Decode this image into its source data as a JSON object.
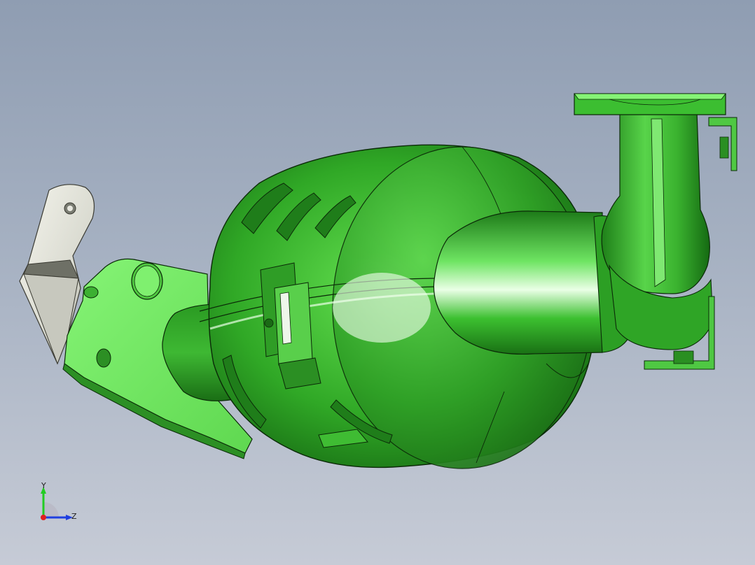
{
  "triad": {
    "y_label": "Y",
    "z_label": "Z",
    "colors": {
      "y_axis": "#22cc22",
      "z_axis": "#1f3fe0",
      "x_axis": "#e02020"
    }
  },
  "model": {
    "icon": "cad-3d-model",
    "colors": {
      "body": "#35b92b",
      "body_dark": "#1c7a18",
      "body_light": "#6fe064",
      "bracket": "#7ff06f",
      "bracket_metal": "#e8e8e0",
      "edge": "#0b2a08",
      "background_top": "#8f9db2",
      "background_bottom": "#c6cbd6"
    }
  }
}
